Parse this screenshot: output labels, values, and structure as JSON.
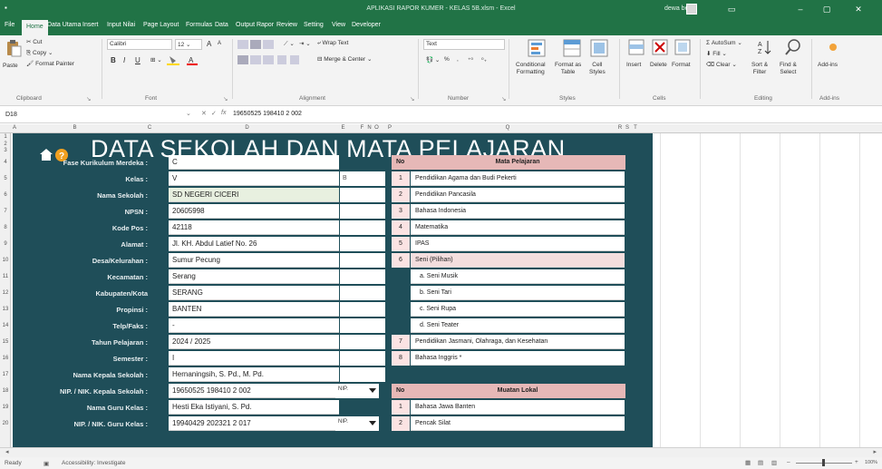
{
  "window": {
    "title": "APLIKASI RAPOR KUMER - KELAS 5B.xlsm  -  Excel",
    "user": "dewa belor",
    "accent": "#217346"
  },
  "tabs": [
    "File",
    "Home",
    "Data Utama",
    "Insert",
    "Input Nilai",
    "Page Layout",
    "Formulas",
    "Data",
    "Output Rapor",
    "Review",
    "Setting",
    "View",
    "Developer"
  ],
  "ribbon": {
    "clipboard": {
      "paste": "Paste",
      "cut": "Cut",
      "copy": "Copy",
      "format_painter": "Format Painter",
      "label": "Clipboard"
    },
    "font": {
      "name": "Calibri",
      "size": "12",
      "label": "Font",
      "bold": "B",
      "italic": "I",
      "underline": "U",
      "grow": "A",
      "shrink": "A"
    },
    "alignment": {
      "wrap": "Wrap Text",
      "merge": "Merge & Center",
      "label": "Alignment"
    },
    "number": {
      "format": "Text",
      "percent": "%",
      "label": "Number"
    },
    "styles": {
      "conditional": "Conditional\nFormatting",
      "format_table": "Format as\nTable",
      "cell_styles": "Cell\nStyles",
      "label": "Styles"
    },
    "cells": {
      "insert": "Insert",
      "delete": "Delete",
      "format": "Format",
      "label": "Cells"
    },
    "editing": {
      "autosum": "AutoSum",
      "fill": "Fill",
      "clear": "Clear",
      "sort": "Sort &\nFilter",
      "find": "Find &\nSelect",
      "label": "Editing"
    },
    "addins": {
      "addins": "Add-ins",
      "label": "Add-ins"
    }
  },
  "formula_bar": {
    "name_box": "D18",
    "fx": "fx",
    "content": "19650525 198410 2 002"
  },
  "columns": [
    "A",
    "B",
    "C",
    "D",
    "E",
    "F",
    "N",
    "O",
    "P",
    "Q",
    "R",
    "S",
    "T"
  ],
  "rows": [
    "1",
    "2",
    "3",
    "4",
    "5",
    "6",
    "7",
    "8",
    "9",
    "10",
    "11",
    "12",
    "13",
    "14",
    "15",
    "16",
    "17",
    "18",
    "19",
    "20"
  ],
  "sheet": {
    "banner": "DATA SEKOLAH DAN MATA PELAJARAN",
    "fields": [
      {
        "label": "Fase Kurikulum Merdeka :",
        "value": "C"
      },
      {
        "label": "Kelas :",
        "value": "V"
      },
      {
        "label": "Nama Sekolah :",
        "value": "SD NEGERI CICERI"
      },
      {
        "label": "NPSN :",
        "value": "20605998"
      },
      {
        "label": "Kode Pos :",
        "value": "42118"
      },
      {
        "label": "Alamat :",
        "value": "Jl. KH. Abdul Latief No. 26"
      },
      {
        "label": "Desa/Kelurahan :",
        "value": "Sumur Pecung"
      },
      {
        "label": "Kecamatan :",
        "value": "Serang"
      },
      {
        "label": "Kabupaten/Kota",
        "value": "SERANG"
      },
      {
        "label": "Propinsi :",
        "value": "BANTEN"
      },
      {
        "label": "Telp/Faks :",
        "value": "-"
      },
      {
        "label": "Tahun Pelajaran :",
        "value": "2024 / 2025"
      },
      {
        "label": "Semester :",
        "value": "I"
      },
      {
        "label": "Nama Kepala Sekolah :",
        "value": "Hernaningsih, S. Pd., M. Pd."
      },
      {
        "label": "NIP. / NIK. Kepala Sekolah :",
        "value": "19650525 198410 2 002"
      },
      {
        "label": "Nama Guru Kelas :",
        "value": "Hesti Eka Istiyani, S. Pd."
      },
      {
        "label": "NIP. / NIK. Guru Kelas :",
        "value": "19940429 202321 2 017"
      }
    ],
    "kelas_extra": "B",
    "nip_dropdown": "NIP.",
    "mapel_header": {
      "no": "No",
      "title": "Mata Pelajaran"
    },
    "mapel": [
      {
        "no": "1",
        "name": "Pendidikan Agama dan Budi Pekerti"
      },
      {
        "no": "2",
        "name": "Pendidikan Pancasila"
      },
      {
        "no": "3",
        "name": "Bahasa Indonesia"
      },
      {
        "no": "4",
        "name": "Matematika"
      },
      {
        "no": "5",
        "name": "IPAS"
      },
      {
        "no": "6",
        "name": "Seni (Pilihan)"
      },
      {
        "no": "",
        "name": "a.  Seni Musik"
      },
      {
        "no": "",
        "name": "b.  Seni Tari"
      },
      {
        "no": "",
        "name": "c.  Seni Rupa"
      },
      {
        "no": "",
        "name": "d.  Seni Teater"
      },
      {
        "no": "7",
        "name": "Pendidikan Jasmani, Olahraga, dan Kesehatan"
      },
      {
        "no": "8",
        "name": "Bahasa Inggris *"
      }
    ],
    "mulok_header": {
      "no": "No",
      "title": "Muatan Lokal"
    },
    "mulok": [
      {
        "no": "1",
        "name": "Bahasa Jawa Banten"
      },
      {
        "no": "2",
        "name": "Pencak Silat"
      }
    ],
    "colors": {
      "teal": "#1f4e59",
      "header_pink": "#e6b8b7",
      "no_pink": "#fbe3e3"
    }
  },
  "status": {
    "ready": "Ready",
    "accessibility": "Accessibility: Investigate",
    "zoom": "100%"
  }
}
